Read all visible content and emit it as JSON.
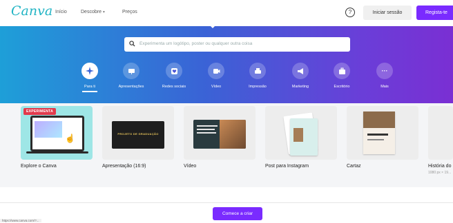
{
  "nav": {
    "logo": "Canva",
    "links": [
      "Início",
      "Descobre",
      "Preços"
    ],
    "login_label": "Iniciar sessão",
    "register_label": "Regista-te"
  },
  "search": {
    "placeholder": "Experimenta um logótipo, poster ou qualquer outra coisa"
  },
  "categories": [
    {
      "label": "Para ti",
      "icon": "sparkle-icon"
    },
    {
      "label": "Apresentações",
      "icon": "presentation-icon"
    },
    {
      "label": "Redes sociais",
      "icon": "heart-icon"
    },
    {
      "label": "Vídeo",
      "icon": "video-icon"
    },
    {
      "label": "Impressão",
      "icon": "printer-icon"
    },
    {
      "label": "Marketing",
      "icon": "megaphone-icon"
    },
    {
      "label": "Escritório",
      "icon": "briefcase-icon"
    },
    {
      "label": "Mais",
      "icon": "more-icon"
    }
  ],
  "cards": [
    {
      "title": "Explore o Canva",
      "badge": "EXPERIMENTA"
    },
    {
      "title": "Apresentação (16:9)",
      "thumb_text": "PROJETO DE GRADUAÇÃO"
    },
    {
      "title": "Vídeo"
    },
    {
      "title": "Post para Instagram"
    },
    {
      "title": "Cartaz"
    },
    {
      "title": "História do",
      "sub": "1080 px × 19..."
    }
  ],
  "cta_label": "Comece a criar",
  "status_url": "https://www.canva.com/?...",
  "colors": {
    "brand_purple": "#7a2bff",
    "hero_start": "#1e9fd8",
    "hero_end": "#7a2fd3",
    "badge_red": "#e23a4c"
  }
}
